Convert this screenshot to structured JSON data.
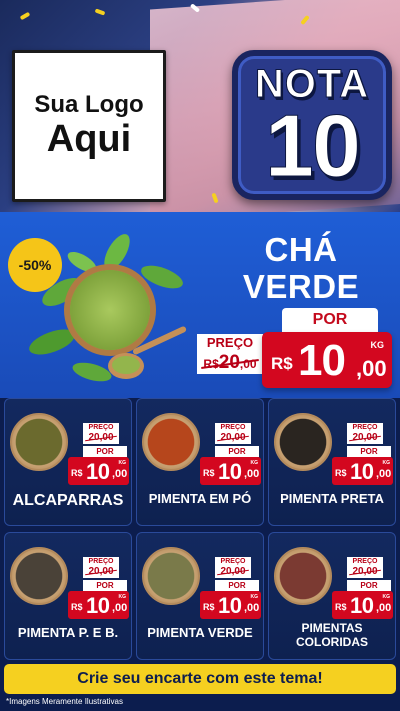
{
  "header": {
    "logo_line1": "Sua Logo",
    "logo_line2": "Aqui",
    "badge_word": "NOTA",
    "badge_number": "10"
  },
  "hero": {
    "discount": "-50%",
    "name_line1": "CHÁ",
    "name_line2": "VERDE",
    "por_label": "POR",
    "preco_label": "PREÇO",
    "old_currency": "R$",
    "old_int": "20",
    "old_cents": ",00",
    "currency": "R$",
    "price_int": "10",
    "price_cents": ",00",
    "unit": "KG",
    "image_icon": "green-tea-bowl-icon"
  },
  "products": [
    {
      "name": "ALCAPARRAS",
      "preco_label": "PREÇO",
      "old_price": "20",
      "old_cents": ",00",
      "por_label": "POR",
      "currency": "R$",
      "price_int": "10",
      "price_cents": ",00",
      "unit": "KG",
      "color": "#6b6a2e",
      "icon": "capers-bowl-icon"
    },
    {
      "name": "PIMENTA EM PÓ",
      "preco_label": "PREÇO",
      "old_price": "20",
      "old_cents": ",00",
      "por_label": "POR",
      "currency": "R$",
      "price_int": "10",
      "price_cents": ",00",
      "unit": "KG",
      "color": "#b6461c",
      "icon": "paprika-bowl-icon"
    },
    {
      "name": "PIMENTA PRETA",
      "preco_label": "PREÇO",
      "old_price": "20",
      "old_cents": ",00",
      "por_label": "POR",
      "currency": "R$",
      "price_int": "10",
      "price_cents": ",00",
      "unit": "KG",
      "color": "#2a2520",
      "icon": "black-pepper-bowl-icon"
    },
    {
      "name": "PIMENTA P. E B.",
      "preco_label": "PREÇO",
      "old_price": "20",
      "old_cents": ",00",
      "por_label": "POR",
      "currency": "R$",
      "price_int": "10",
      "price_cents": ",00",
      "unit": "KG",
      "color": "#4a4238",
      "icon": "mixed-pepper-bowl-icon"
    },
    {
      "name": "PIMENTA VERDE",
      "preco_label": "PREÇO",
      "old_price": "20",
      "old_cents": ",00",
      "por_label": "POR",
      "currency": "R$",
      "price_int": "10",
      "price_cents": ",00",
      "unit": "KG",
      "color": "#7a7a4a",
      "icon": "green-pepper-bowl-icon"
    },
    {
      "name": "PIMENTAS COLORIDAS",
      "preco_label": "PREÇO",
      "old_price": "20",
      "old_cents": ",00",
      "por_label": "POR",
      "currency": "R$",
      "price_int": "10",
      "price_cents": ",00",
      "unit": "KG",
      "color": "#7b3a32",
      "icon": "colored-pepper-bowl-icon"
    }
  ],
  "cta": {
    "label": "Crie seu encarte com este tema!"
  },
  "footer": {
    "disclaimer": "*Imagens Meramente Ilustrativas"
  },
  "colors": {
    "primary_blue": "#1f5ed6",
    "dark_navy": "#0c1d4e",
    "price_red": "#d3071f",
    "cta_yellow": "#f5d020",
    "discount_yellow": "#f5c518"
  }
}
